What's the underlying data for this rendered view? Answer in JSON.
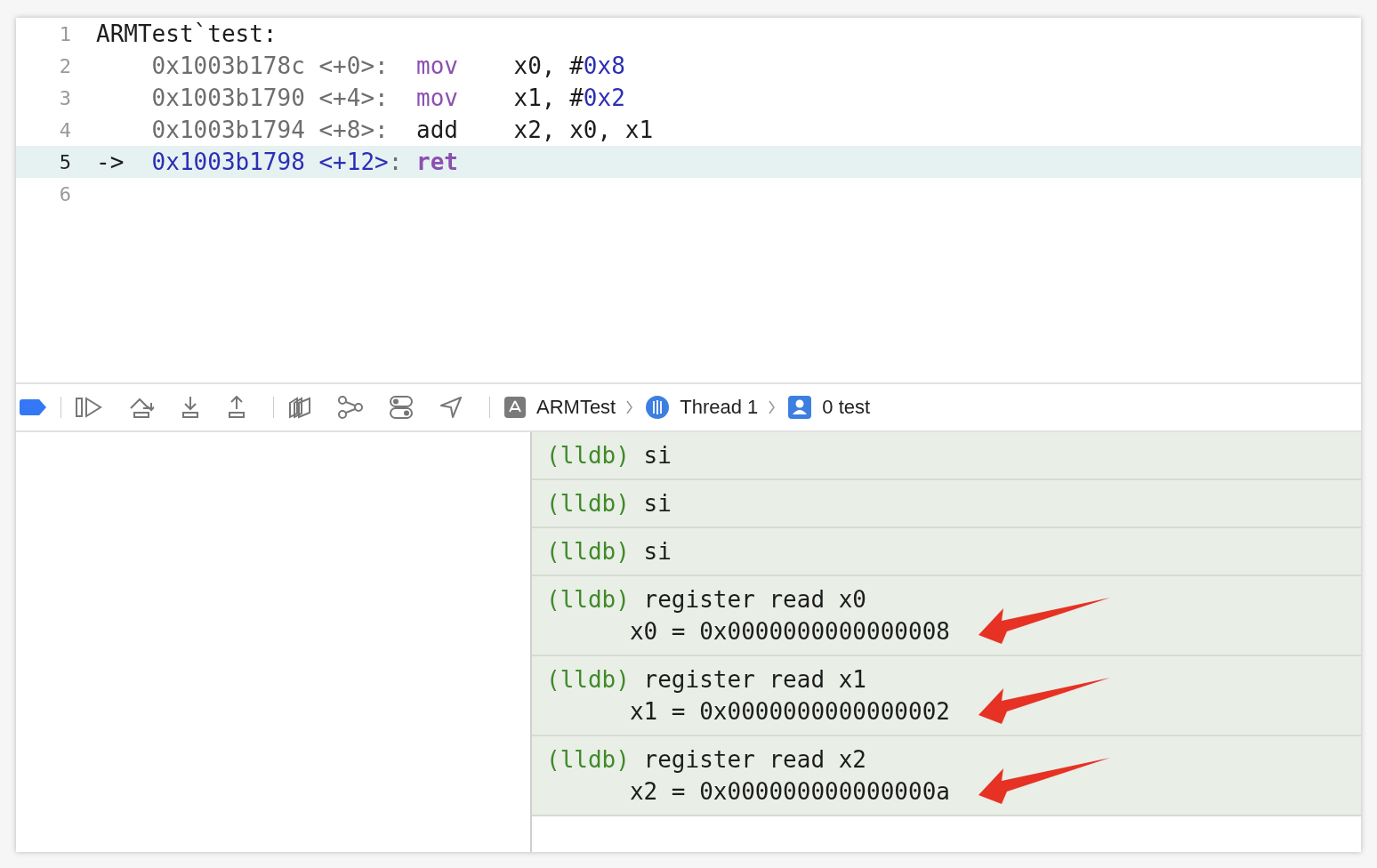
{
  "editor": {
    "lines": [
      {
        "number": "1",
        "kind": "label",
        "text": "ARMTest`test:",
        "current": false
      },
      {
        "number": "2",
        "kind": "instruction",
        "address": "0x1003b178c",
        "offset": "<+0>",
        "colon": ":",
        "mnemonic": "mov",
        "keyword": true,
        "operands": [
          {
            "text": "x0, #",
            "kind": "plain"
          },
          {
            "text": "0x8",
            "kind": "number"
          }
        ],
        "current": false
      },
      {
        "number": "3",
        "kind": "instruction",
        "address": "0x1003b1790",
        "offset": "<+4>",
        "colon": ":",
        "mnemonic": "mov",
        "keyword": true,
        "operands": [
          {
            "text": "x1, #",
            "kind": "plain"
          },
          {
            "text": "0x2",
            "kind": "number"
          }
        ],
        "current": false
      },
      {
        "number": "4",
        "kind": "instruction",
        "address": "0x1003b1794",
        "offset": "<+8>",
        "colon": ":",
        "mnemonic": "add",
        "keyword": false,
        "operands": [
          {
            "text": "x2, x0, x1",
            "kind": "plain"
          }
        ],
        "current": false
      },
      {
        "number": "5",
        "kind": "instruction",
        "marker": "->",
        "address": "0x1003b1798",
        "offset": "<+12>",
        "colon": ":",
        "mnemonic": "ret",
        "keyword": true,
        "current": true
      },
      {
        "number": "6",
        "kind": "empty",
        "current": false
      }
    ]
  },
  "debug_bar": {
    "breakpoints_on": true,
    "breadcrumb": [
      {
        "label": "ARMTest"
      },
      {
        "label": "Thread 1"
      },
      {
        "label": "0 test"
      }
    ]
  },
  "console": {
    "entries": [
      {
        "prompt": "(lldb)",
        "command": "si",
        "arrow": false
      },
      {
        "prompt": "(lldb)",
        "command": "si",
        "arrow": false
      },
      {
        "prompt": "(lldb)",
        "command": "si",
        "arrow": false
      },
      {
        "prompt": "(lldb)",
        "command": "register read x0",
        "outputs": [
          "x0 = 0x0000000000000008"
        ],
        "arrow": true
      },
      {
        "prompt": "(lldb)",
        "command": "register read x1",
        "outputs": [
          "x1 = 0x0000000000000002"
        ],
        "arrow": true
      },
      {
        "prompt": "(lldb)",
        "command": "register read x2",
        "outputs": [
          "x2 = 0x000000000000000a"
        ],
        "arrow": true
      }
    ]
  }
}
